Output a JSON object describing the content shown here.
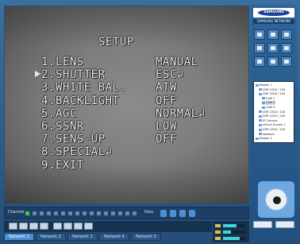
{
  "osd": {
    "title": "SETUP",
    "selected_index": 1,
    "items": [
      {
        "num": "1.",
        "label": "LENS",
        "value": "MANUAL"
      },
      {
        "num": "2.",
        "label": "SHUTTER",
        "value": "ESC↲"
      },
      {
        "num": "3.",
        "label": "WHITE BAL.",
        "value": "ATW"
      },
      {
        "num": "4.",
        "label": "BACKLIGHT",
        "value": "OFF"
      },
      {
        "num": "5.",
        "label": "AGC",
        "value": "NORMAL↲"
      },
      {
        "num": "6.",
        "label": "SSNR",
        "value": "LOW"
      },
      {
        "num": "7.",
        "label": "SENS-UP",
        "value": "OFF"
      },
      {
        "num": "8.",
        "label": "SPECIAL↲",
        "value": ""
      },
      {
        "num": "9.",
        "label": "EXIT",
        "value": ""
      }
    ]
  },
  "timeline": {
    "label": "Channel",
    "speed_label": "Pass",
    "active_channel": 1,
    "channel_count": 16
  },
  "tabs": [
    "Network 1",
    "Network 2",
    "Network 3",
    "Network 4",
    "Network 5"
  ],
  "brand": {
    "logo_text": "SAMSUNG",
    "subtitle": "SAMSUNG NETWORK"
  },
  "tree": {
    "items": [
      {
        "label": "Region 1",
        "indent": 0
      },
      {
        "label": "DVR 1000 / 100",
        "indent": 1
      },
      {
        "label": "DVR 3000 / 100",
        "indent": 1
      },
      {
        "label": "CAM 1",
        "indent": 2
      },
      {
        "label": "CAM 2",
        "indent": 2
      },
      {
        "label": "CAM 3",
        "indent": 2
      },
      {
        "label": "DVR 1000 / 100",
        "indent": 1
      },
      {
        "label": "DVR 1000 / 100",
        "indent": 1
      },
      {
        "label": "IP Camera",
        "indent": 1
      },
      {
        "label": "Virtual Screen 1",
        "indent": 1
      },
      {
        "label": "DVR 1000 / 100",
        "indent": 1
      },
      {
        "label": "Network",
        "indent": 1
      },
      {
        "label": "Region 2",
        "indent": 0
      }
    ],
    "selected_index": 4
  },
  "colors": {
    "accent": "#3e7fc1",
    "osd_text": "#e8e8e8",
    "active_dot": "#3ecb3e"
  }
}
